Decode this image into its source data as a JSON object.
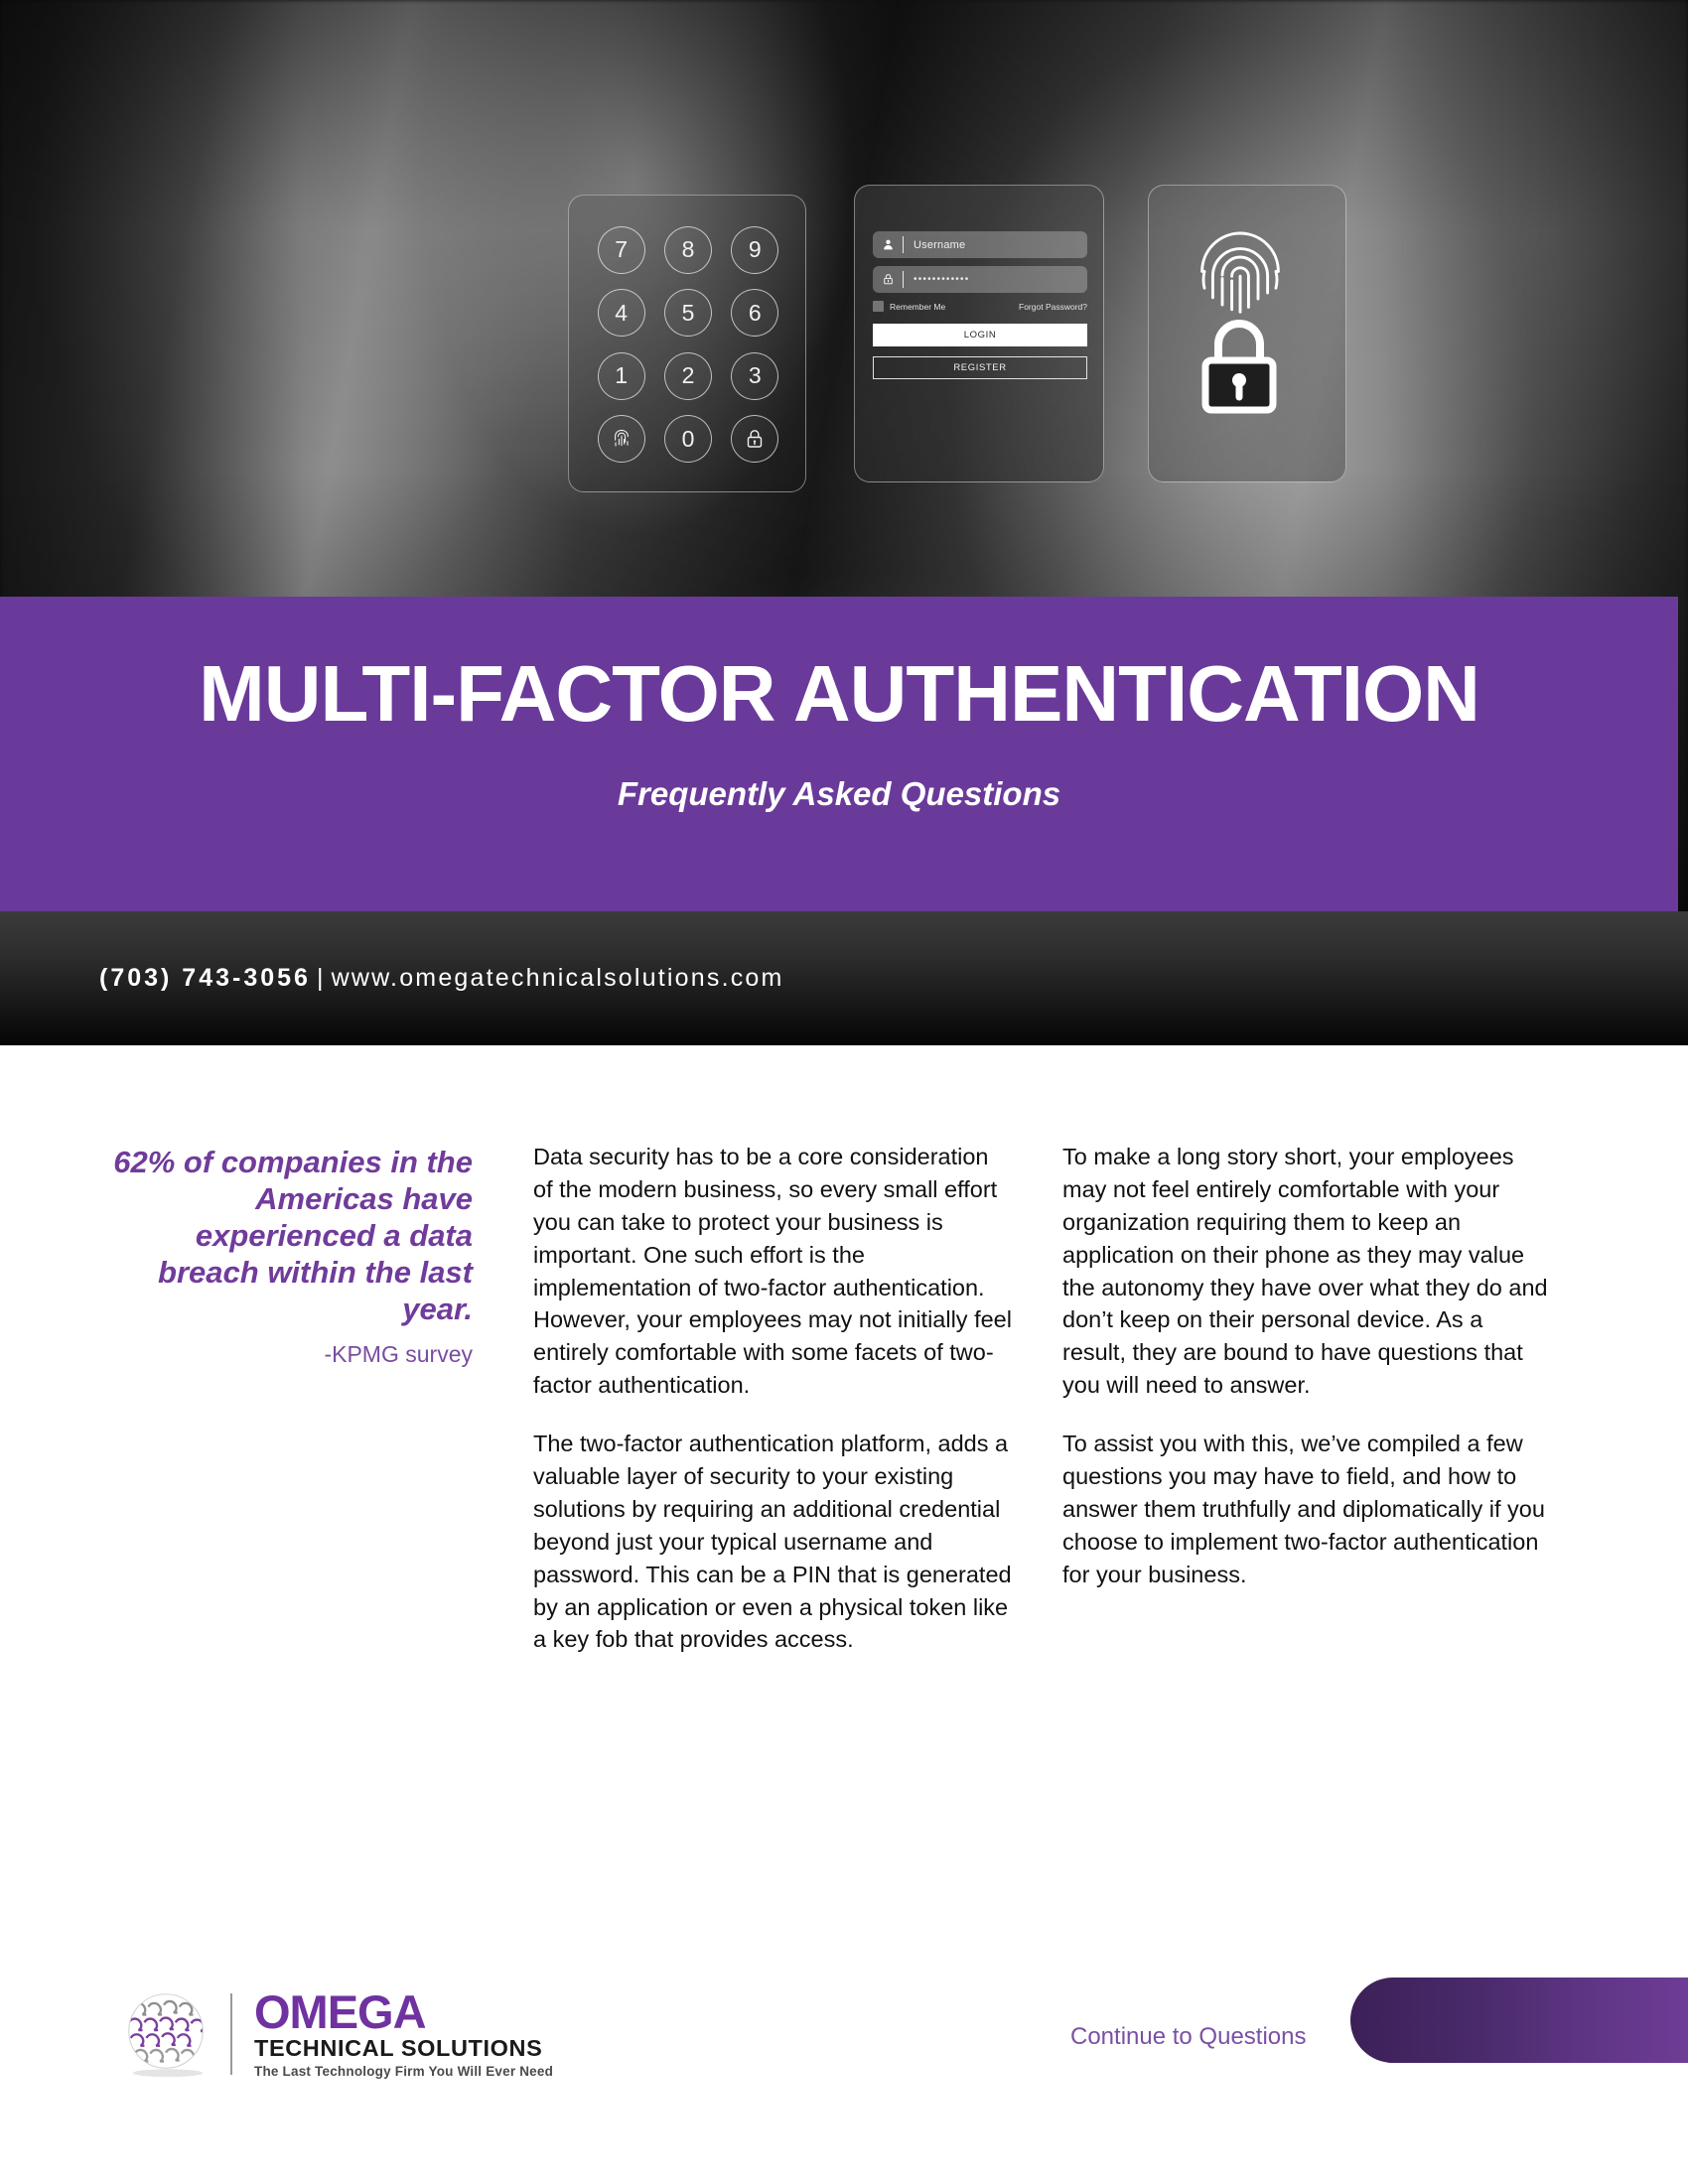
{
  "hero": {
    "keypad": {
      "name": "numeric-keypad",
      "keys": [
        "7",
        "8",
        "9",
        "4",
        "5",
        "6",
        "1",
        "2",
        "3",
        "fingerprint-icon",
        "0",
        "lock-icon"
      ]
    },
    "login_panel": {
      "username_placeholder": "Username",
      "password_masked": "••••••••••••",
      "remember_label": "Remember Me",
      "forgot_label": "Forgot Password?",
      "login_button": "LOGIN",
      "register_button": "REGISTER"
    },
    "biometric_panel": {
      "icons": [
        "fingerprint-icon",
        "padlock-icon"
      ]
    }
  },
  "title_band": {
    "title": "MULTI-FACTOR AUTHENTICATION",
    "subtitle": "Frequently Asked Questions",
    "background_color": "#6A3A9A"
  },
  "contact": {
    "phone": "(703) 743-3056",
    "separator": "|",
    "website": "www.omegatechnicalsolutions.com"
  },
  "quote": {
    "text": "62% of companies in the Americas have experienced a data breach within the last year.",
    "citation": "-KPMG survey",
    "color": "#703B9B"
  },
  "body": {
    "middle_column": [
      "Data security has to be a core consideration of the modern business, so every small effort you can take to protect your business is important. One such effort is the implementation of two-factor authentication. However, your employees may not initially feel entirely comfortable with some facets of two-factor authentication.",
      "The two-factor authentication platform, adds a valuable layer of security to your existing solutions by requiring an additional credential beyond just your typical username and password. This can be a PIN that is generated by an application or even a physical token like a key fob that provides access."
    ],
    "right_column": [
      "To make a long story short, your employees may not feel entirely comfortable with your organization requiring them to keep an application on their phone as they may value the autonomy they have over what they do and don’t keep on their personal device. As a result, they are bound to have questions that you will need to answer.",
      "To assist you with this, we’ve compiled a few questions you may have to field, and how to answer them truthfully and diplomatically if you choose to implement two-factor authentication for your business."
    ]
  },
  "footer": {
    "logo": {
      "brand": "OMEGA",
      "sub_brand": "TECHNICAL SOLUTIONS",
      "tagline": "The Last Technology Firm You Will Ever Need",
      "brand_color": "#6F32A0"
    },
    "continue_link": "Continue to Questions",
    "cta_color_start": "#3C2057",
    "cta_color_end": "#6E3C95"
  }
}
